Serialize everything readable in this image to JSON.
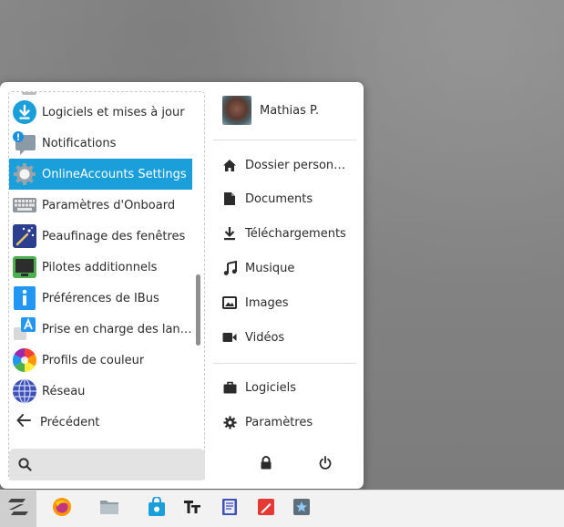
{
  "app_list": {
    "items": [
      {
        "label": "Logiciels et mises à jour",
        "icon": "software-update-icon"
      },
      {
        "label": "Notifications",
        "icon": "notifications-icon"
      },
      {
        "label": "OnlineAccounts Settings",
        "icon": "online-accounts-gear-icon",
        "selected": true
      },
      {
        "label": "Paramètres d'Onboard",
        "icon": "keyboard-icon"
      },
      {
        "label": "Peaufinage des fenêtres",
        "icon": "window-tweaks-icon"
      },
      {
        "label": "Pilotes additionnels",
        "icon": "drivers-chip-icon"
      },
      {
        "label": "Préférences de IBus",
        "icon": "info-icon"
      },
      {
        "label": "Prise en charge des lan…",
        "icon": "language-support-icon"
      },
      {
        "label": "Profils de couleur",
        "icon": "color-wheel-icon"
      },
      {
        "label": "Réseau",
        "icon": "network-globe-icon"
      }
    ]
  },
  "nav": {
    "back_label": "Précédent"
  },
  "search": {
    "placeholder": ""
  },
  "user": {
    "name": "Mathias P."
  },
  "places": [
    {
      "label": "Dossier person…",
      "icon": "home-icon"
    },
    {
      "label": "Documents",
      "icon": "documents-icon"
    },
    {
      "label": "Téléchargements",
      "icon": "download-icon"
    },
    {
      "label": "Musique",
      "icon": "music-icon"
    },
    {
      "label": "Images",
      "icon": "image-icon"
    },
    {
      "label": "Vidéos",
      "icon": "video-icon"
    }
  ],
  "system": [
    {
      "label": "Logiciels",
      "icon": "briefcase-icon"
    },
    {
      "label": "Paramètres",
      "icon": "gear-icon"
    }
  ],
  "colors": {
    "accent": "#1a9fdb",
    "panel": "#ffffff",
    "taskbar": "#f2f2f2"
  }
}
